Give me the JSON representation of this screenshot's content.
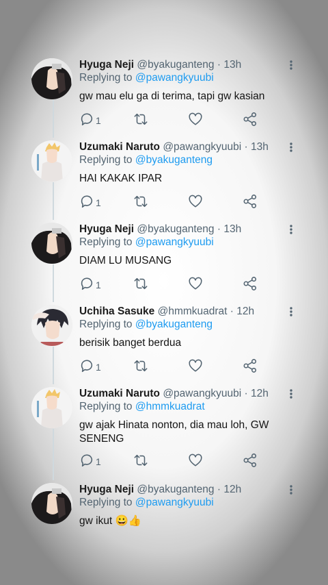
{
  "colors": {
    "accent": "#1d9bf0",
    "secondary_text": "#536471",
    "thread_line": "#cfd9de"
  },
  "replying_label": "Replying to",
  "separator": "·",
  "tweets": [
    {
      "name": "Hyuga Neji",
      "handle": "@byakuganteng",
      "time": "13h",
      "replying_to": "@pawangkyuubi",
      "text": "gw mau elu ga di terima, tapi gw kasian",
      "reply_count": "1",
      "avatar_icon": "neji-avatar-icon"
    },
    {
      "name": "Uzumaki Naruto",
      "handle": "@pawangkyuubi",
      "time": "13h",
      "replying_to": "@byakuganteng",
      "text": "HAI KAKAK IPAR",
      "reply_count": "1",
      "avatar_icon": "naruto-avatar-icon"
    },
    {
      "name": "Hyuga Neji",
      "handle": "@byakuganteng",
      "time": "13h",
      "replying_to": "@pawangkyuubi",
      "text": "DIAM LU MUSANG",
      "reply_count": "1",
      "avatar_icon": "neji-avatar-icon"
    },
    {
      "name": "Uchiha Sasuke",
      "handle": "@hmmkuadrat",
      "time": "12h",
      "replying_to": "@byakuganteng",
      "text": "berisik banget berdua",
      "reply_count": "1",
      "avatar_icon": "sasuke-avatar-icon"
    },
    {
      "name": "Uzumaki Naruto",
      "handle": "@pawangkyuubi",
      "time": "12h",
      "replying_to": "@hmmkuadrat",
      "text": "gw ajak Hinata nonton, dia mau loh, GW SENENG",
      "reply_count": "1",
      "avatar_icon": "naruto-avatar-icon"
    },
    {
      "name": "Hyuga Neji",
      "handle": "@byakuganteng",
      "time": "12h",
      "replying_to": "@pawangkyuubi",
      "text": "gw ikut 😀👍",
      "reply_count": "",
      "avatar_icon": "neji-avatar-icon"
    }
  ]
}
